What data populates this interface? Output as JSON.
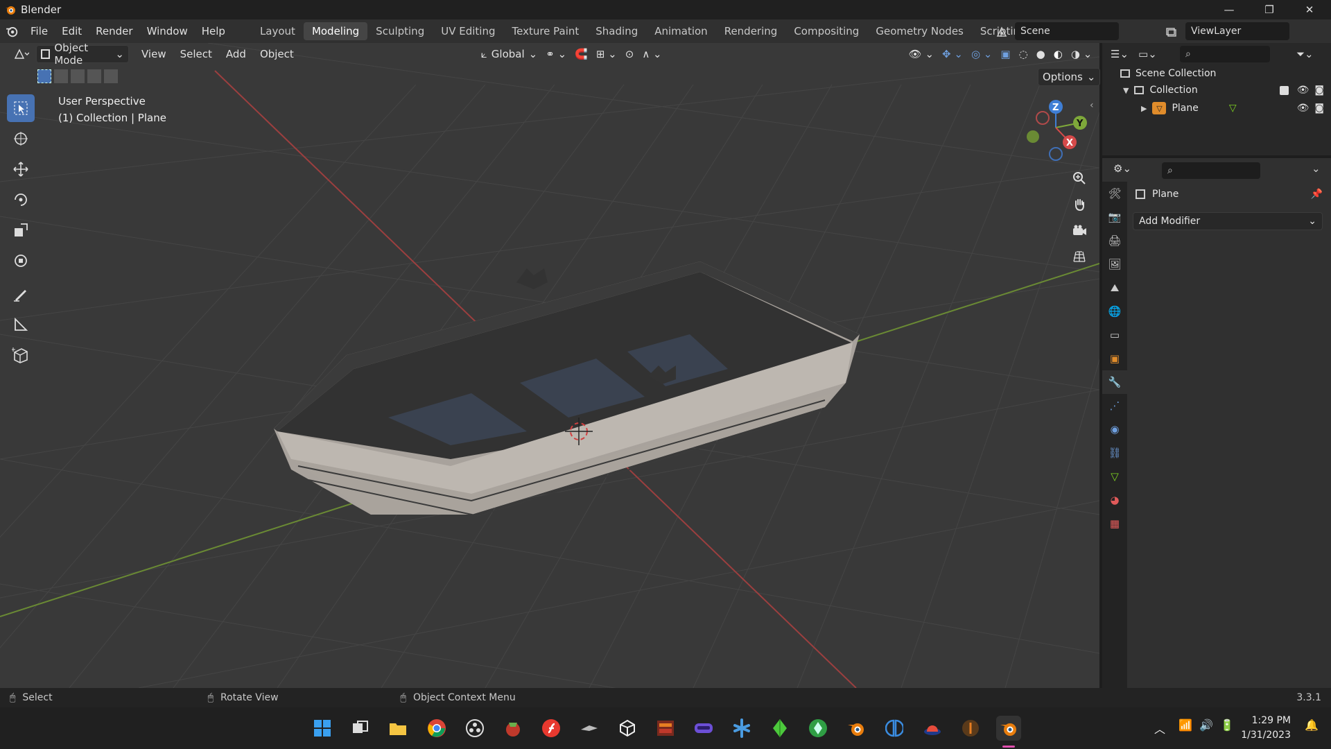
{
  "app": {
    "title": "Blender",
    "version": "3.3.1"
  },
  "window_controls": {
    "minimize": "—",
    "restore": "❐",
    "close": "✕"
  },
  "menu": {
    "items": [
      "File",
      "Edit",
      "Render",
      "Window",
      "Help"
    ]
  },
  "workspaces": {
    "tabs": [
      "Layout",
      "Modeling",
      "Sculpting",
      "UV Editing",
      "Texture Paint",
      "Shading",
      "Animation",
      "Rendering",
      "Compositing",
      "Geometry Nodes",
      "Scripting"
    ],
    "active": "Modeling",
    "add": "+"
  },
  "scene": {
    "name": "Scene",
    "view_layer": "ViewLayer"
  },
  "viewport_header": {
    "mode": "Object Mode",
    "menus": [
      "View",
      "Select",
      "Add",
      "Object"
    ],
    "orientation": "Global",
    "options": "Options"
  },
  "viewport": {
    "perspective_label": "User Perspective",
    "context_label": "(1) Collection | Plane",
    "gizmo_axes": [
      "X",
      "Y",
      "Z"
    ]
  },
  "outliner": {
    "root": "Scene Collection",
    "collection": "Collection",
    "object": "Plane"
  },
  "properties": {
    "object_name": "Plane",
    "add_modifier": "Add Modifier"
  },
  "status_bar": {
    "left": "Select",
    "middle": "Rotate View",
    "right": "Object Context Menu"
  },
  "system_tray": {
    "time": "1:29 PM",
    "date": "1/31/2023"
  },
  "colors": {
    "accent": "#4772b3",
    "active_tab": "#454545",
    "x_axis": "#d64a4a",
    "y_axis": "#7ea83a",
    "z_axis": "#3f7fd6"
  }
}
